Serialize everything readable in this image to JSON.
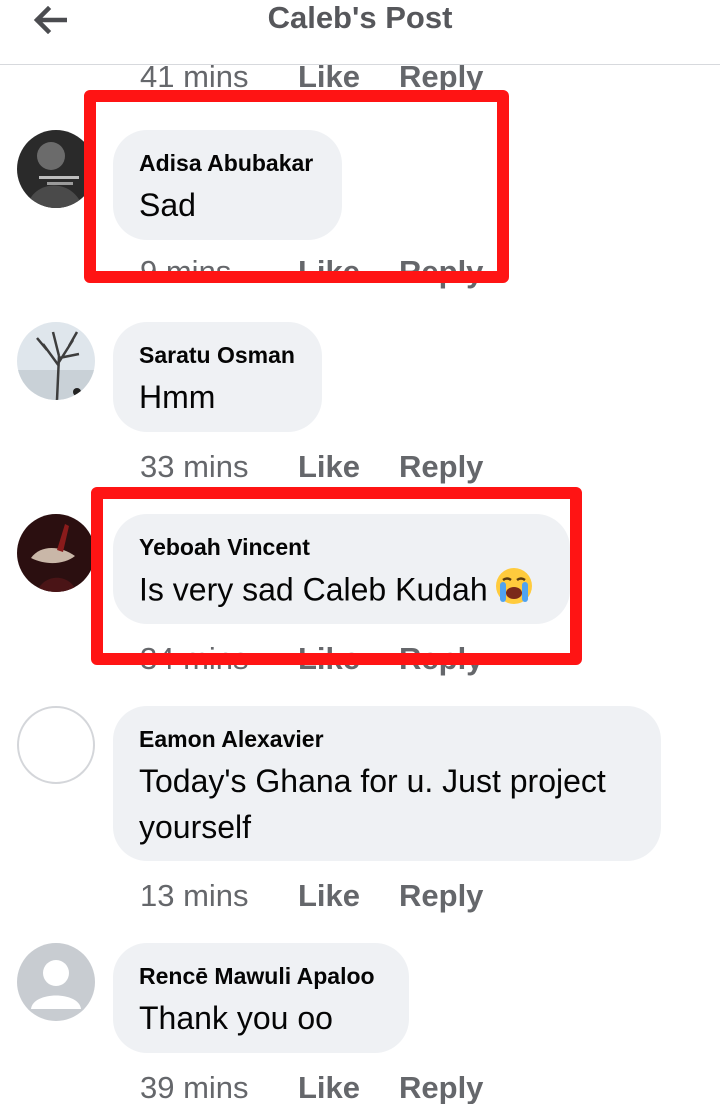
{
  "header": {
    "title": "Caleb's Post",
    "back_icon": "arrow-left-icon"
  },
  "comments": [
    {
      "name": "Adisa Abubakar",
      "text": "Sad",
      "time": "9 mins",
      "like": "Like",
      "reply": "Reply"
    },
    {
      "name": "Saratu Osman",
      "text": "Hmm",
      "time": "33 mins",
      "like": "Like",
      "reply": "Reply"
    },
    {
      "name": "Yeboah Vincent",
      "text": "Is very sad Caleb Kudah",
      "emoji": "crying-face-emoji",
      "time": "34 mins",
      "like": "Like",
      "reply": "Reply"
    },
    {
      "name": "Eamon Alexavier",
      "text": "Today's Ghana for u. Just project yourself",
      "time": "13 mins",
      "like": "Like",
      "reply": "Reply"
    },
    {
      "name": "Rencē Mawuli Apaloo",
      "text": "Thank you oo",
      "time": "39 mins",
      "like": "Like",
      "reply": "Reply"
    }
  ],
  "top_partial": {
    "time": "41 mins",
    "like": "Like",
    "reply": "Reply"
  },
  "highlight_color": "#ff1414"
}
